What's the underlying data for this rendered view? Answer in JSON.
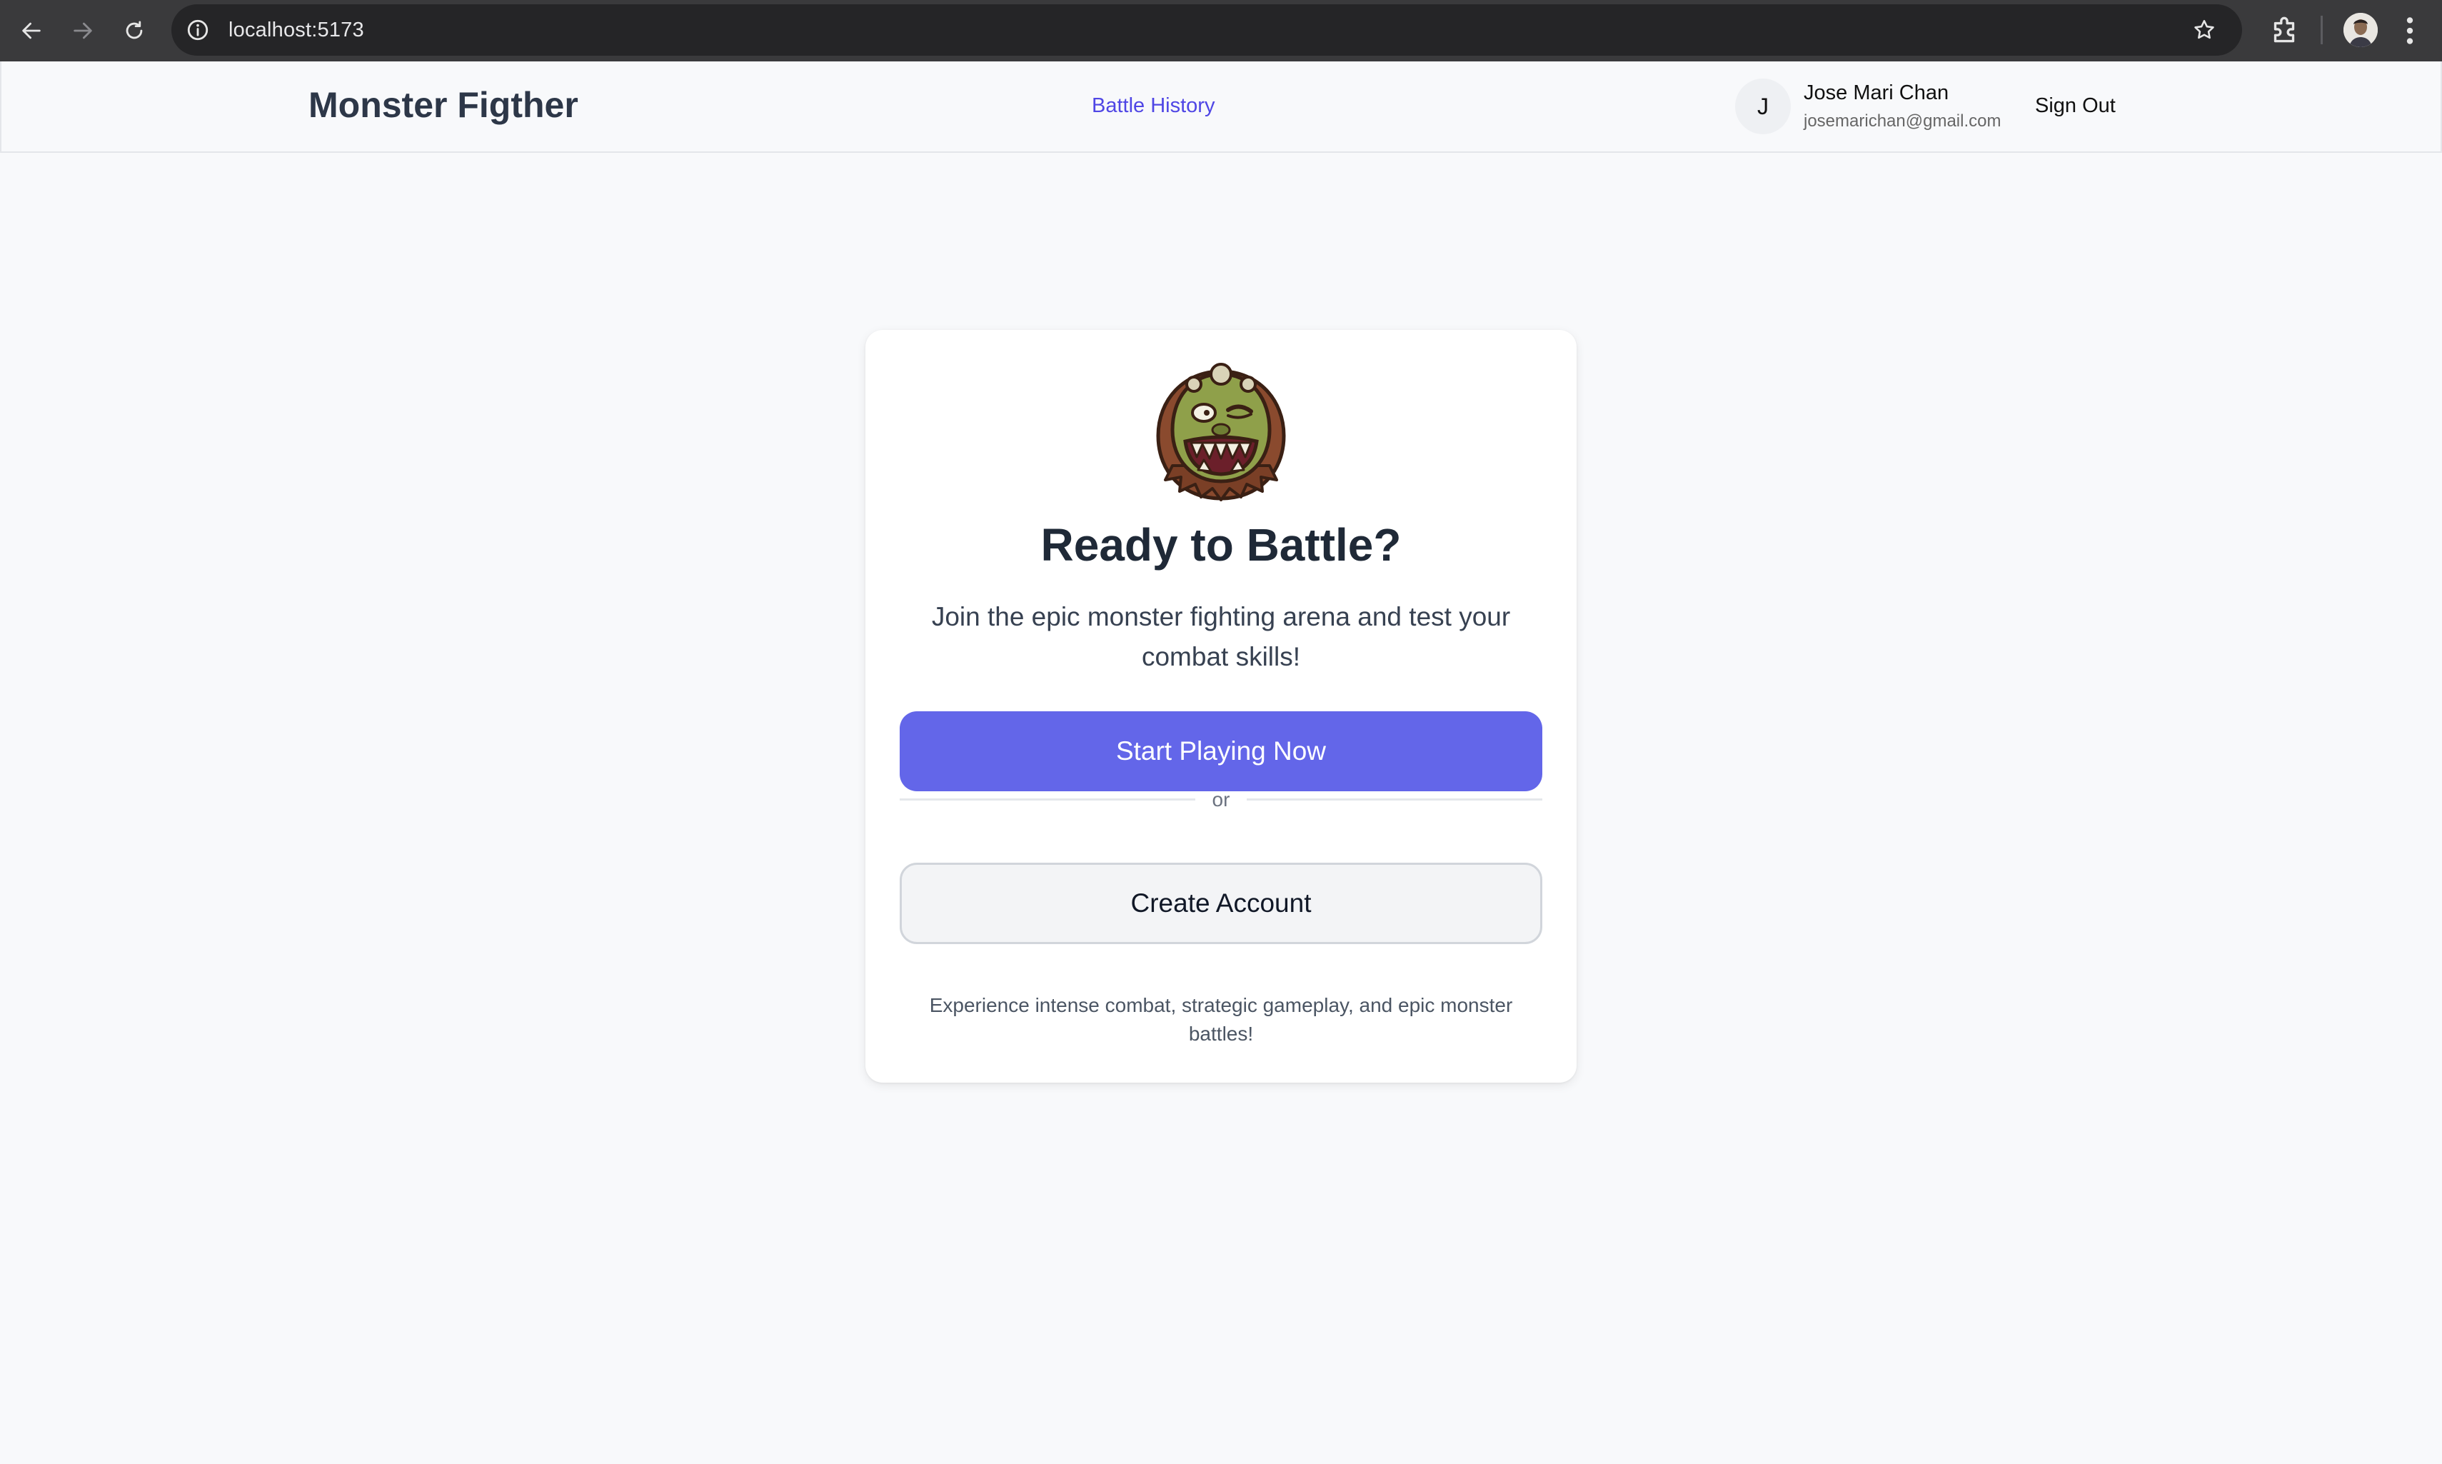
{
  "browser": {
    "url": "localhost:5173"
  },
  "header": {
    "brand": "Monster Figther",
    "nav_link": "Battle History",
    "user": {
      "initial": "J",
      "name": "Jose Mari Chan",
      "email": "josemarichan@gmail.com"
    },
    "sign_out": "Sign Out"
  },
  "card": {
    "image_icon": "monster-face-icon",
    "title": "Ready to Battle?",
    "subtitle": "Join the epic monster fighting arena and test your combat skills!",
    "primary_button": "Start Playing Now",
    "divider_text": "or",
    "secondary_button": "Create Account",
    "footer": "Experience intense combat, strategic gameplay, and epic monster battles!"
  },
  "colors": {
    "accent": "#6366e9",
    "link": "#4f46e5",
    "background": "#f8f9fb"
  }
}
